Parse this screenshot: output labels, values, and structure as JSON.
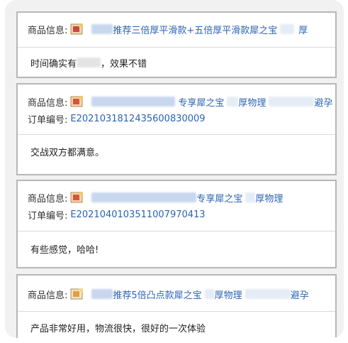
{
  "reviews": [
    {
      "product_label": "商品信息:",
      "product_name_a": "推荐三倍厚平滑款+五倍厚平滑款犀之宝",
      "product_name_b": "",
      "product_tail": "厚",
      "comment_a": "时间确实有",
      "comment_b": "，效果不错"
    },
    {
      "product_label": "商品信息:",
      "product_name_a": "专享犀之宝",
      "product_name_b": "厚物理",
      "product_tail": "避孕",
      "order_label": "订单编号:",
      "order_number": "E2021031812435600830009",
      "comment_a": "交战双方都满意。"
    },
    {
      "product_label": "商品信息:",
      "product_name_a": "专享犀之宝",
      "product_name_b": "厚物理",
      "order_label": "订单编号:",
      "order_number": "E2021040103511007970413",
      "comment_a": "有些感觉，哈哈!"
    },
    {
      "product_label": "商品信息:",
      "product_name_a": "推荐5倍凸点款犀之宝",
      "product_name_b": "厚物理",
      "product_tail": "避孕",
      "comment_a": "产品非常好用，物流很快，很好的一次体验"
    }
  ],
  "icons": {
    "product_thumbnail": "product-thumbnail-icon"
  },
  "colors": {
    "link": "#2b63b3",
    "card_border": "#b7b7b7",
    "frame_bg": "#f1f1f1"
  }
}
